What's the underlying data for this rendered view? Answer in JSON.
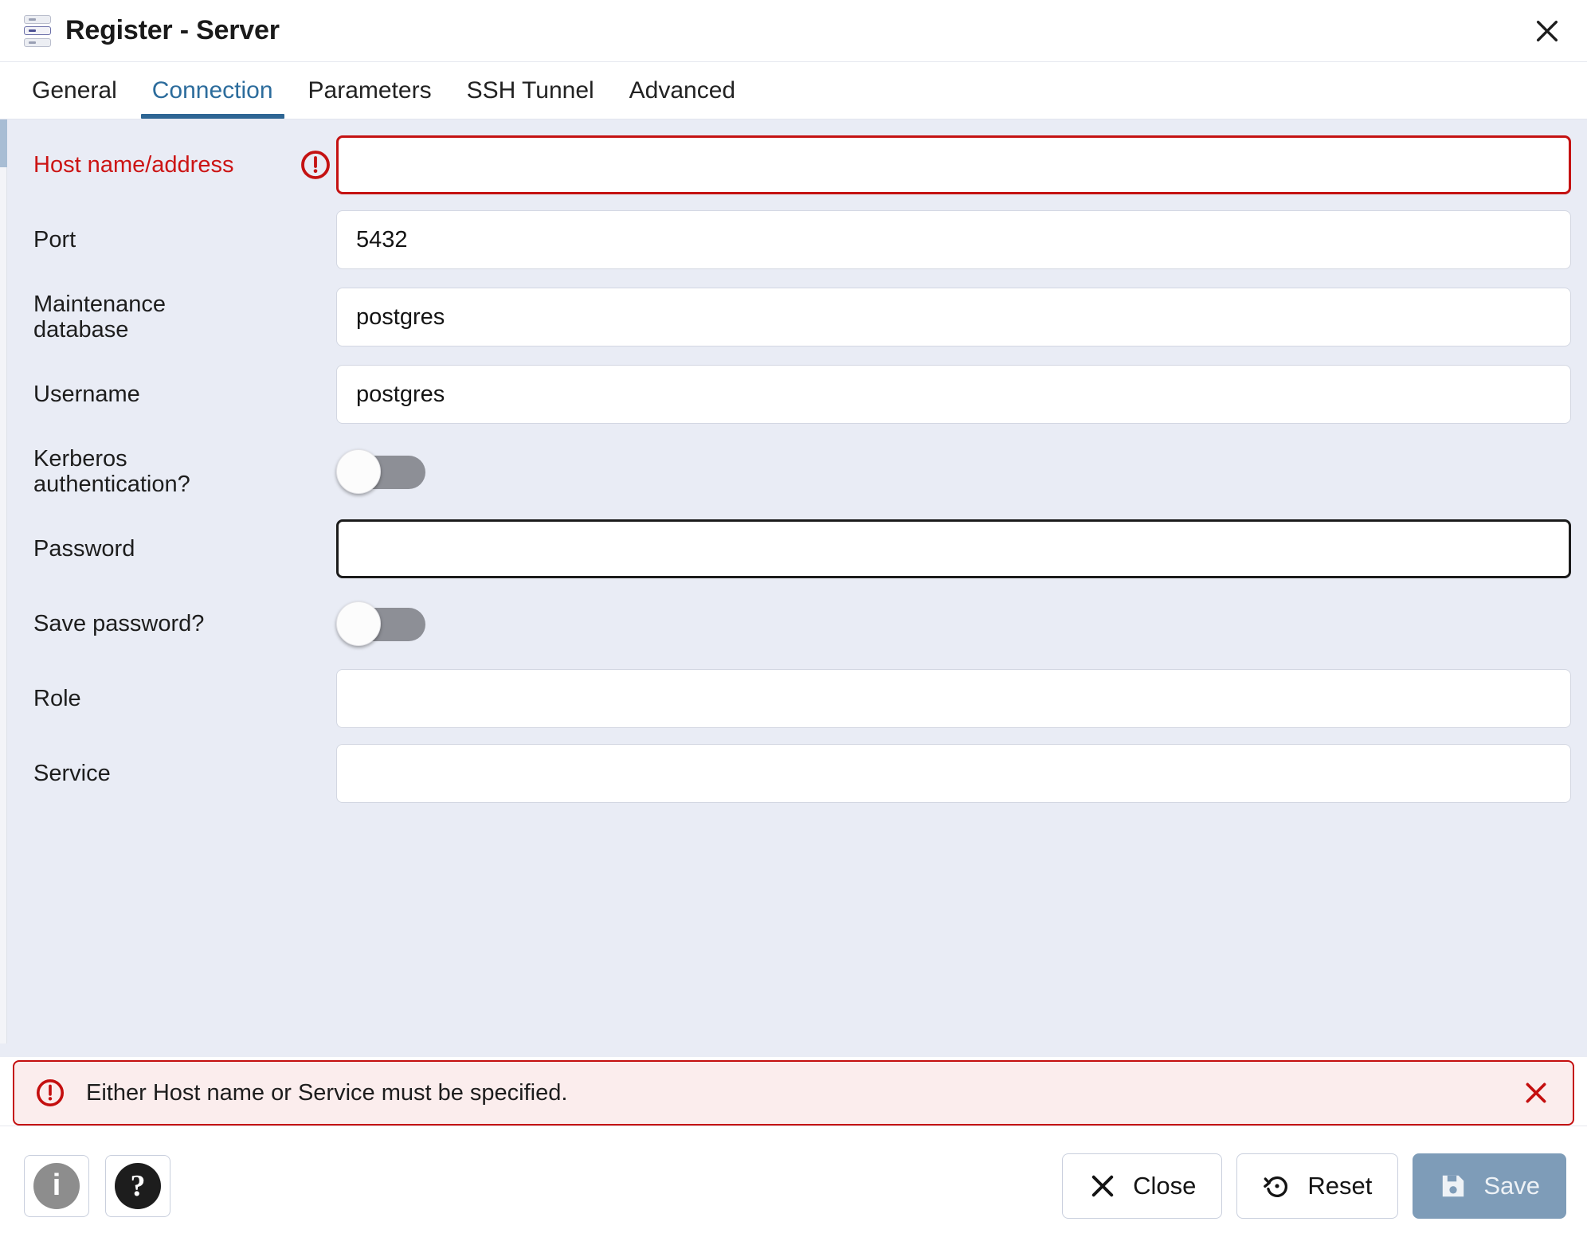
{
  "window": {
    "title": "Register - Server",
    "icon": "server-icon",
    "close_label": "×"
  },
  "tabs": [
    {
      "label": "General",
      "active": false
    },
    {
      "label": "Connection",
      "active": true
    },
    {
      "label": "Parameters",
      "active": false
    },
    {
      "label": "SSH Tunnel",
      "active": false
    },
    {
      "label": "Advanced",
      "active": false
    }
  ],
  "fields": {
    "host": {
      "label": "Host name/address",
      "value": "",
      "placeholder": "",
      "state": "error",
      "icon": "exclamation-circle-icon"
    },
    "port": {
      "label": "Port",
      "value": "5432",
      "placeholder": ""
    },
    "maintenance_db": {
      "label": "Maintenance\ndatabase",
      "value": "postgres",
      "placeholder": ""
    },
    "username": {
      "label": "Username",
      "value": "postgres",
      "placeholder": ""
    },
    "kerberos": {
      "label": "Kerberos\nauthentication?",
      "value": "off"
    },
    "password": {
      "label": "Password",
      "value": "",
      "placeholder": "",
      "state": "focused"
    },
    "save_password": {
      "label": "Save password?",
      "value": "off"
    },
    "role": {
      "label": "Role",
      "value": "",
      "placeholder": ""
    },
    "service": {
      "label": "Service",
      "value": "",
      "placeholder": ""
    }
  },
  "alert": {
    "message": "Either Host name or Service must be specified.",
    "icon": "exclamation-circle-icon",
    "close_icon": "close-icon",
    "border_color": "#c40f0f",
    "background_color": "#fbeded"
  },
  "footer": {
    "info_label": "i",
    "help_label": "?",
    "close_label": "Close",
    "reset_label": "Reset",
    "save_label": "Save"
  },
  "colors": {
    "accent": "#2e6694",
    "error": "#c40f0f",
    "error_label": "#cc1414",
    "form_background": "#e9ecf5",
    "save_disabled": "#7e9cb8"
  }
}
